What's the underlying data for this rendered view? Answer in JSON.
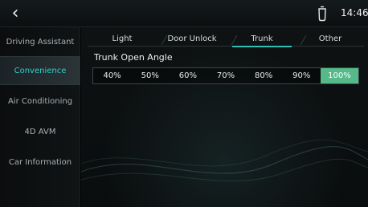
{
  "header": {
    "back_glyph": "‹",
    "clock": "14:46",
    "status_icon": "cup-icon"
  },
  "sidebar": {
    "items": [
      {
        "label": "Driving Assistant",
        "active": false
      },
      {
        "label": "Convenience",
        "active": true
      },
      {
        "label": "Air Conditioning",
        "active": false
      },
      {
        "label": "4D AVM",
        "active": false
      },
      {
        "label": "Car Information",
        "active": false
      }
    ]
  },
  "tabs": [
    {
      "label": "Light",
      "active": false
    },
    {
      "label": "Door Unlock",
      "active": false
    },
    {
      "label": "Trunk",
      "active": true
    },
    {
      "label": "Other",
      "active": false
    }
  ],
  "trunk": {
    "section_label": "Trunk Open Angle",
    "options": [
      "40%",
      "50%",
      "60%",
      "70%",
      "80%",
      "90%",
      "100%"
    ],
    "selected": "100%"
  },
  "colors": {
    "accent_teal": "#33d0c6",
    "selected_green": "#56b98a"
  }
}
